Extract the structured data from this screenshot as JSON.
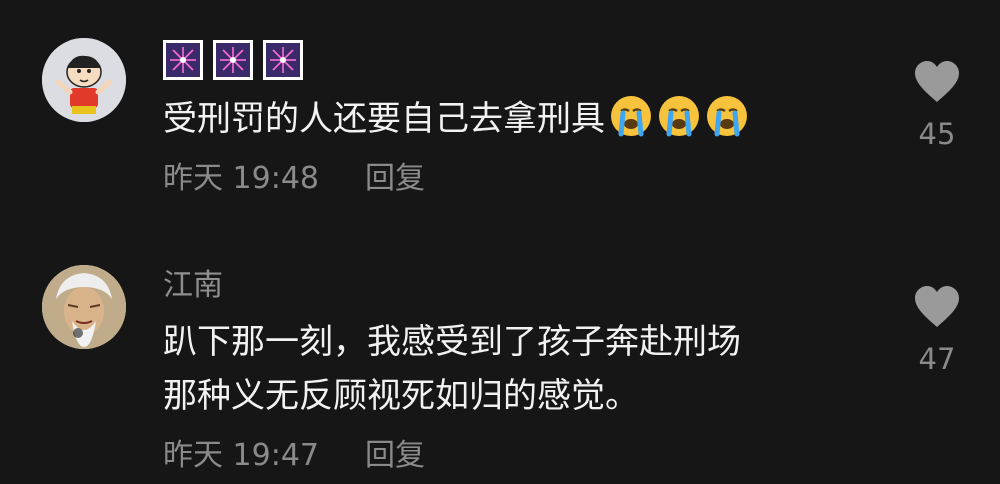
{
  "comments": [
    {
      "author": "",
      "text_lines": [
        "受刑罚的人还要自己去拿刑具"
      ],
      "emojis": [
        "loudly-crying-face-icon",
        "loudly-crying-face-icon",
        "loudly-crying-face-icon"
      ],
      "name_emojis": [
        "fireworks-icon",
        "fireworks-icon",
        "fireworks-icon"
      ],
      "time": "昨天 19:48",
      "reply_label": "回复",
      "likes": "45"
    },
    {
      "author": "江南",
      "text_lines": [
        "趴下那一刻，我感受到了孩子奔赴刑场",
        "那种义无反顾视死如归的感觉。"
      ],
      "time": "昨天 19:47",
      "reply_label": "回复",
      "likes": "47"
    }
  ],
  "colors": {
    "background": "#161616",
    "text_primary": "#f2f2f2",
    "text_secondary": "#8a8a8a",
    "heart": "#9a9a9a"
  }
}
